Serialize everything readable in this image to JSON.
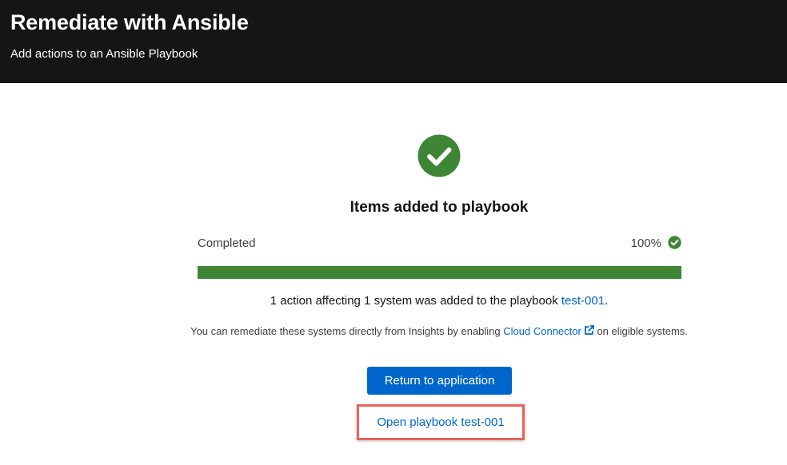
{
  "header": {
    "title": "Remediate with Ansible",
    "subtitle": "Add actions to an Ansible Playbook"
  },
  "main": {
    "title": "Items added to playbook",
    "progress": {
      "label": "Completed",
      "value_text": "100%",
      "value": 100
    },
    "result": {
      "text": "1 action affecting 1 system was added to the playbook ",
      "playbook_link": "test-001",
      "suffix": "."
    },
    "info": {
      "text_before": "You can remediate these systems directly from Insights by enabling ",
      "link": "Cloud Connector",
      "text_after": " on eligible systems."
    },
    "return_button": "Return to application",
    "open_playbook_link": "Open playbook test-001"
  },
  "colors": {
    "header_bg": "#151515",
    "success": "#3e8635",
    "link": "#0066cc",
    "primary_button": "#0066cc",
    "highlight": "#e8645a"
  },
  "icons": {
    "success": "check-circle-icon",
    "progress_complete": "check-circle-icon",
    "external": "external-link-icon"
  }
}
